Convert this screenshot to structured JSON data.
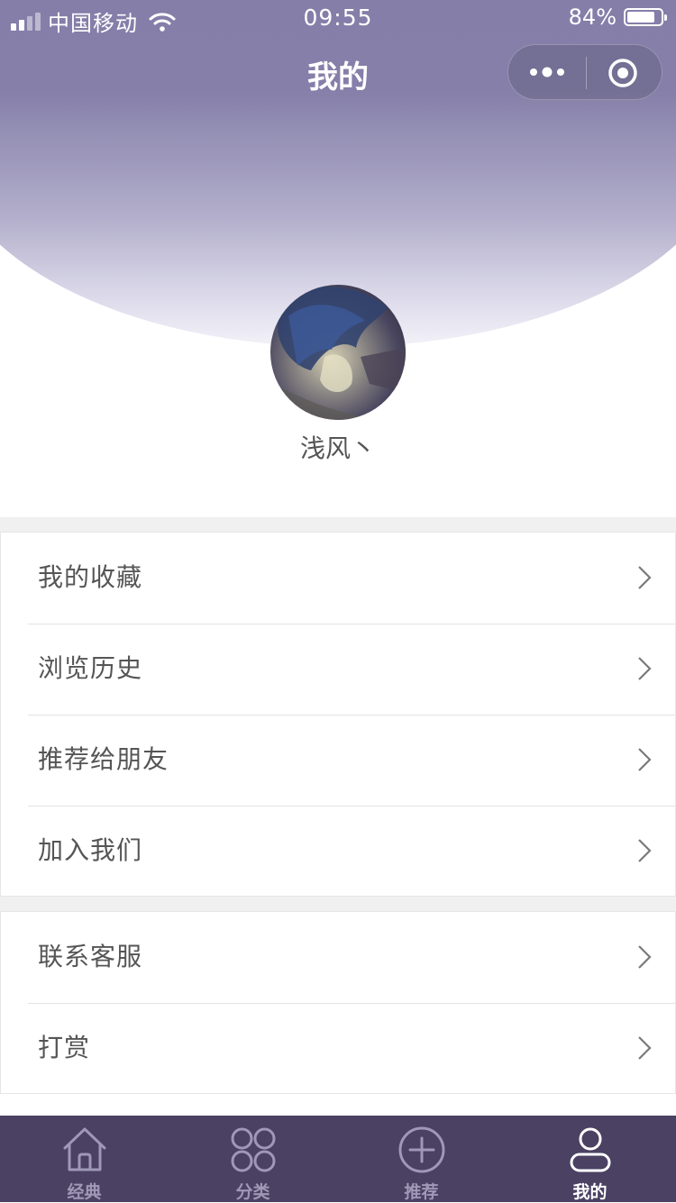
{
  "status_bar": {
    "carrier": "中国移动",
    "time": "09:55",
    "battery_percent": "84%",
    "battery_level": 0.84
  },
  "nav": {
    "title": "我的",
    "more_icon": "more-dots-icon",
    "close_icon": "target-circle-icon"
  },
  "profile": {
    "username": "浅风丶"
  },
  "menu_group_1": [
    {
      "label": "我的收藏"
    },
    {
      "label": "浏览历史"
    },
    {
      "label": "推荐给朋友"
    },
    {
      "label": "加入我们"
    }
  ],
  "menu_group_2": [
    {
      "label": "联系客服"
    },
    {
      "label": "打赏"
    }
  ],
  "tabbar": {
    "tabs": [
      {
        "label": "经典",
        "icon": "home-icon",
        "active": false
      },
      {
        "label": "分类",
        "icon": "grid-icon",
        "active": false
      },
      {
        "label": "推荐",
        "icon": "plus-circle-icon",
        "active": false
      },
      {
        "label": "我的",
        "icon": "user-icon",
        "active": true
      }
    ]
  },
  "colors": {
    "header_gradient_top": "#817ba6",
    "tabbar_bg": "#4a4163",
    "tab_inactive": "#9f98b6",
    "tab_active": "#ffffff"
  }
}
